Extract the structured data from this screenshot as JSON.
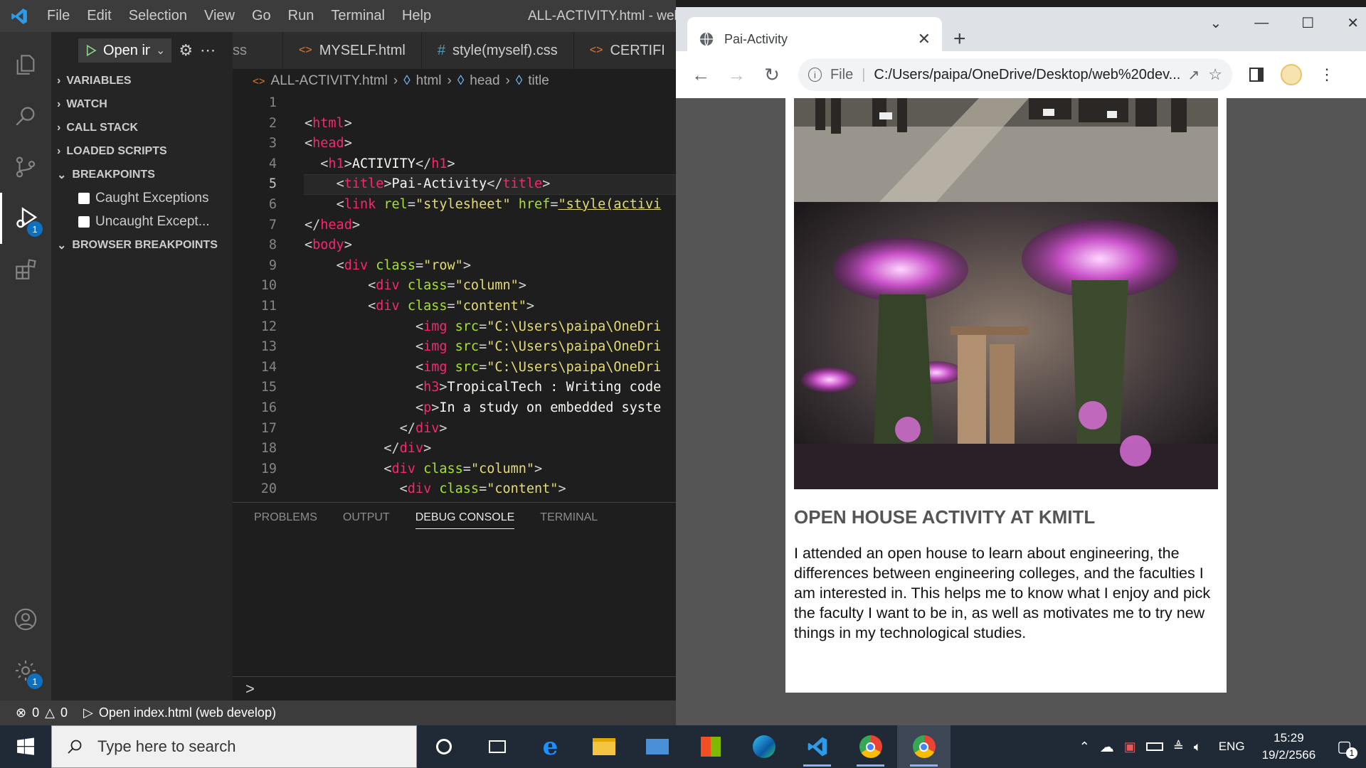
{
  "vscode": {
    "menu": [
      "File",
      "Edit",
      "Selection",
      "View",
      "Go",
      "Run",
      "Terminal",
      "Help"
    ],
    "window_title": "ALL-ACTIVITY.html - web d",
    "run_config": "Open in",
    "activity_badges": {
      "debug": "1",
      "manage": "1"
    },
    "sidebar": {
      "sections": [
        "VARIABLES",
        "WATCH",
        "CALL STACK",
        "LOADED SCRIPTS",
        "BREAKPOINTS"
      ],
      "breakpoints": [
        "Caught Exceptions",
        "Uncaught Except..."
      ],
      "browser_breakpoints": "BROWSER BREAKPOINTS"
    },
    "tabs": [
      {
        "label": "ss",
        "icon": "#"
      },
      {
        "label": "MYSELF.html",
        "icon": "<>"
      },
      {
        "label": "style(myself).css",
        "icon": "#"
      },
      {
        "label": "CERTIFI",
        "icon": "<>"
      }
    ],
    "breadcrumb": [
      "ALL-ACTIVITY.html",
      "html",
      "head",
      "title"
    ],
    "code_line_numbers": [
      "1",
      "2",
      "3",
      "4",
      "5",
      "6",
      "7",
      "8",
      "9",
      "10",
      "11",
      "12",
      "13",
      "14",
      "15",
      "16",
      "17",
      "18",
      "19",
      "20"
    ],
    "panel_tabs": [
      "PROBLEMS",
      "OUTPUT",
      "DEBUG CONSOLE",
      "TERMINAL"
    ],
    "panel_prompt": ">",
    "status": {
      "errors": "0",
      "warnings": "0",
      "launch": "Open index.html (web develop)"
    }
  },
  "chrome": {
    "tab_title": "Pai-Activity",
    "new_tab": "+",
    "url_scheme": "File",
    "url": "C:/Users/paipa/OneDrive/Desktop/web%20dev...",
    "page": {
      "heading": "OPEN HOUSE ACTIVITY AT KMITL",
      "paragraph": "I attended an open house to learn about engineering, the differences between engineering colleges, and the faculties I am interested in. This helps me to know what I enjoy and pick the faculty I want to be in, as well as motivates me to try new things in my technological studies."
    }
  },
  "taskbar": {
    "search_placeholder": "Type here to search",
    "language": "ENG",
    "time": "15:29",
    "date": "19/2/2566",
    "notification_count": "1"
  }
}
